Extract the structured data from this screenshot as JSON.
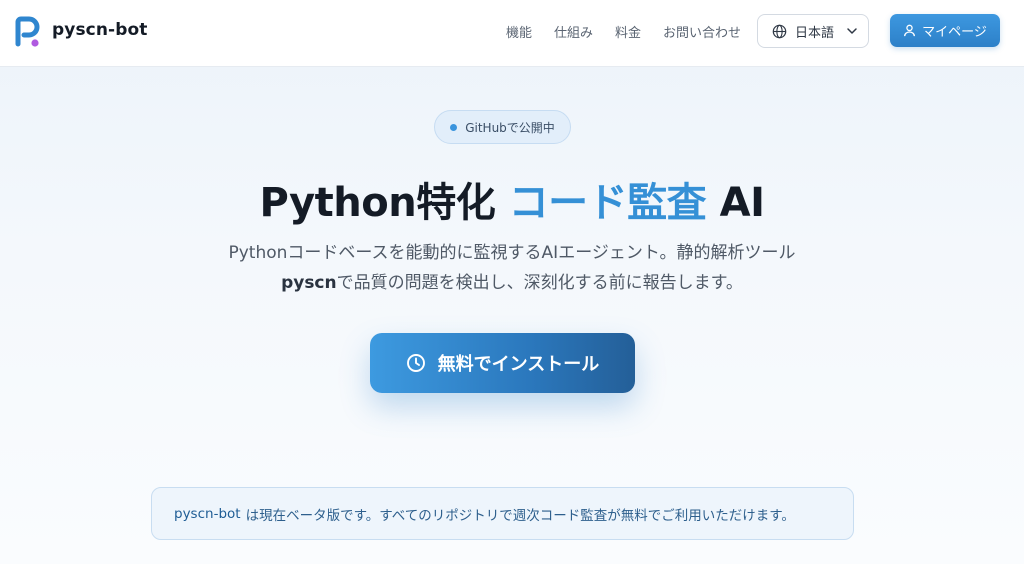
{
  "header": {
    "brand": "pyscn-bot",
    "logo_icon": "pyscn-logo-icon",
    "nav": [
      "機能",
      "仕組み",
      "料金",
      "お問い合わせ"
    ],
    "language": {
      "label": "日本語",
      "icon": "globe-icon"
    },
    "mypage": {
      "label": "マイページ",
      "icon": "user-icon"
    }
  },
  "hero": {
    "badge": "GitHubで公開中",
    "title_prefix": "Python特化",
    "title_accent": "コード監査",
    "title_suffix": "AI",
    "desc_line1": "Pythonコードベースを能動的に監視するAIエージェント。静的解析ツール",
    "desc_bold": "pyscn",
    "desc_line2_rest": "で品質の問題を検出し、深刻化する前に報告します。",
    "install_label": "無料でインストール",
    "install_icon": "clock-icon"
  },
  "notice": {
    "brand": "pyscn-bot",
    "text": "は現在ベータ版です。すべてのリポジトリで週次コード監査が無料でご利用いただけます。"
  },
  "colors": {
    "accent": "#3590d6",
    "button": "#2d80c8",
    "background": "#f4f8fc"
  }
}
